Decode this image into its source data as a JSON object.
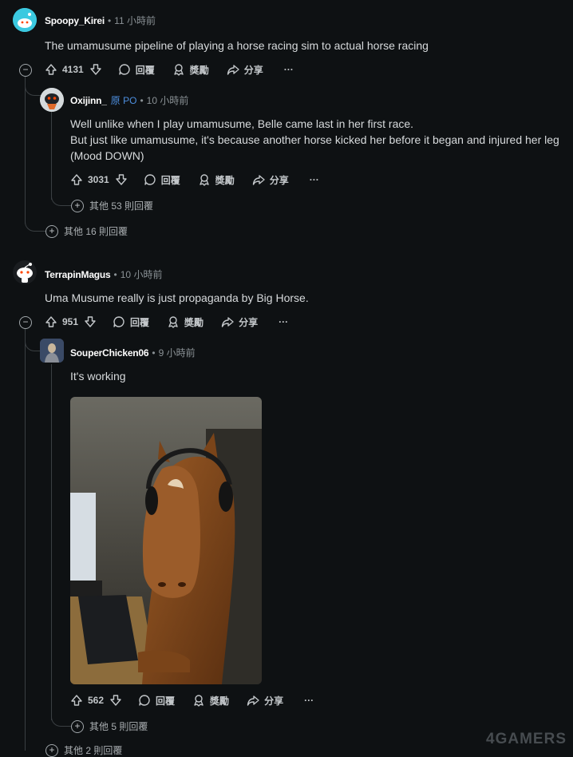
{
  "time_unit": "小時前",
  "actions": {
    "reply": "回覆",
    "award": "獎勵",
    "share": "分享",
    "more": "···"
  },
  "comments": [
    {
      "username": "Spoopy_Kirei",
      "age": "11",
      "text": "The umamusume pipeline of playing a horse racing sim to actual horse racing",
      "score": "4131",
      "collapse_label": "−",
      "more_replies": "其他 16 則回覆",
      "replies": [
        {
          "username": "Oxijinn_",
          "op_badge": "原 PO",
          "age": "10",
          "lines": [
            "Well unlike when I play umamusume, Belle came last in her first race.",
            "But just like umamusume, it's because another horse kicked her before it began and injured her leg",
            "(Mood DOWN)"
          ],
          "score": "3031",
          "more_replies": "其他 53 則回覆"
        }
      ]
    },
    {
      "username": "TerrapinMagus",
      "age": "10",
      "text": "Uma Musume really is just propaganda by Big Horse.",
      "score": "951",
      "collapse_label": "−",
      "more_replies": "其他 2 則回覆",
      "replies": [
        {
          "username": "SouperChicken06",
          "age": "9",
          "text": "It's working",
          "image_alt": "horse wearing headphones at a computer",
          "score": "562",
          "more_replies": "其他 5 則回覆"
        }
      ]
    }
  ],
  "watermark": "4GAMERS"
}
